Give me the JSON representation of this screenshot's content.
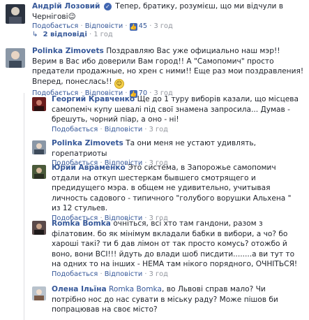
{
  "meta_labels": {
    "reply": "Подобається",
    "respond": "Відповісти",
    "separator": "·"
  },
  "top_comment": {
    "author": "Андрій Лозовий",
    "text": "Тепер, братику, розумієш, що ми відчули в Чернігові😉",
    "likes": "45",
    "time": "3 год"
  },
  "replies_toggle": {
    "label": "2 відповіді",
    "time": "1 год"
  },
  "second_comment": {
    "author": "Polinka Zimovets",
    "text": "Поздравляю Вас уже официально наш мэр!! Верим в Вас ибо доверили Вам город!! А \"Самопомич\" просто предатели продажные, но хрен с ними!! Еще раз мои поздравления! Вперед, понеслась!!",
    "likes": "70",
    "time": "3 год"
  },
  "replies": [
    {
      "author": "Георгий Кравченко",
      "text": "Ще до 1 туру виборів казали, що місцева самопеміч купу шевалі під свої знамена запросила... Думав - брешуть, чорний піар, а оно - ні!",
      "likes": "",
      "time": "3 год"
    },
    {
      "author": "Polinka Zimovets",
      "text": "Та они меня не устают удивлять, горепатриоты",
      "likes": "",
      "time": "3 год"
    },
    {
      "author": "Юрий Авраменко",
      "text": "Это система, в Запорожье самопомич отдали на откуп шестеркам бывшего смотрящего и предидущего мэра. в общем не удивительно, учитывая личность садового - типичного \"голубого ворушки Альхена \" из 12 стульев.",
      "likes": "",
      "time": "3 год"
    },
    {
      "author": "Romka Bomka",
      "text": "очніться, всі хто там гандони, разом з філатовим. бо як мінімум вкладали бабки в вибори, а чо? бо хароші такі? ти б дав лімон от так просто комусь? отожбо й воно, вони ВСІ!!! йдуть до влади шоб писдити........а ви тут то на одних то на інших - НЕМА там нікого порядного, ОЧНІТЬСЯ!",
      "likes": "",
      "time": "3 год"
    },
    {
      "author": "Олена Ільїна",
      "mention": "Romka Bomka",
      "text": ", во Львові справ мало? Чи потрібно нос до нас сувати в міську раду? Може пішов би попрацював на своє місто?",
      "likes": "",
      "time": ""
    }
  ],
  "colors": {
    "link": "#365899",
    "meta": "#90949c",
    "text": "#1d2129",
    "like": "#4267b2"
  }
}
